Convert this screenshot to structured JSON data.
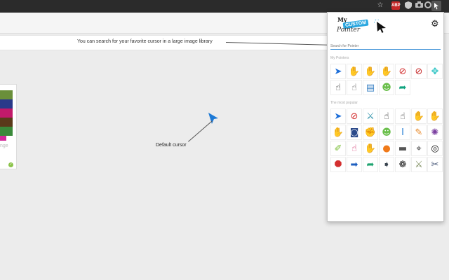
{
  "toolbar": {
    "icons": [
      "star-icon",
      "extension-badge-icon",
      "shield-icon",
      "camera-icon",
      "settings-extension-icon",
      "custom-pointer-extension-icon"
    ],
    "star_glyph": "☆",
    "badge_text": "ABP"
  },
  "page": {
    "info_text": "You can search for your favorite cursor in a large image library",
    "default_cursor_label": "Default cursor",
    "card_label": "nge"
  },
  "popup": {
    "logo": {
      "my": "My",
      "custom": "CUSTOM",
      "pointer": "Pointer"
    },
    "gear_glyph": "⚙",
    "search_placeholder": "Search for Pointer",
    "my_pointers_label": "My Pointers",
    "most_popular_label": "The most popular",
    "my_pointers": [
      {
        "name": "blue-arrow-cursor",
        "glyph": "➤",
        "color": "#1e6fd9"
      },
      {
        "name": "open-hand-cursor",
        "glyph": "✋",
        "color": "#e8b48a"
      },
      {
        "name": "raised-hand-cursor",
        "glyph": "✋",
        "color": "#f0c8a0"
      },
      {
        "name": "palm-hand-cursor",
        "glyph": "✋",
        "color": "#f2cba8"
      },
      {
        "name": "forbidden-hand-cursor",
        "glyph": "⊘",
        "color": "#d32f2f"
      },
      {
        "name": "forbidden-hand-cursor-2",
        "glyph": "⊘",
        "color": "#c62828"
      },
      {
        "name": "move-arrows-cursor",
        "glyph": "✥",
        "color": "#2ec4c4"
      },
      {
        "name": "pointing-hand-cursor",
        "glyph": "☝",
        "color": "#222222"
      },
      {
        "name": "pointing-hand-outline-cursor",
        "glyph": "☝",
        "color": "#555555"
      },
      {
        "name": "notepad-cursor",
        "glyph": "▤",
        "color": "#3b82c4"
      },
      {
        "name": "smiley-ball-cursor",
        "glyph": "☻",
        "color": "#6abf4b"
      },
      {
        "name": "teal-curved-arrow-cursor",
        "glyph": "➦",
        "color": "#10a37f"
      }
    ],
    "popular": [
      {
        "name": "blue-arrow-cursor",
        "glyph": "➤",
        "color": "#1e6fd9"
      },
      {
        "name": "forbidden-hand-cursor",
        "glyph": "⊘",
        "color": "#d32f2f"
      },
      {
        "name": "sword-cursor",
        "glyph": "⚔",
        "color": "#2a8fa8"
      },
      {
        "name": "pointing-hand-cursor",
        "glyph": "☝",
        "color": "#222222"
      },
      {
        "name": "pointing-hand-outline-cursor",
        "glyph": "☝",
        "color": "#444444"
      },
      {
        "name": "skin-hand-cursor",
        "glyph": "✋",
        "color": "#f0c8a0"
      },
      {
        "name": "palm-hand-cursor",
        "glyph": "✋",
        "color": "#f2cba8"
      },
      {
        "name": "open-hand-cursor",
        "glyph": "✋",
        "color": "#e8b48a"
      },
      {
        "name": "camera-cursor",
        "glyph": "◙",
        "color": "#2b4a8a"
      },
      {
        "name": "fist-hand-cursor",
        "glyph": "✊",
        "color": "#d9a07a"
      },
      {
        "name": "smiley-ball-cursor",
        "glyph": "☻",
        "color": "#6abf4b"
      },
      {
        "name": "text-beam-cursor",
        "glyph": "I",
        "color": "#2a7fd4"
      },
      {
        "name": "pencil-cursor",
        "glyph": "✎",
        "color": "#e88a2a"
      },
      {
        "name": "virus-cursor",
        "glyph": "✺",
        "color": "#7b3fa0"
      },
      {
        "name": "syringe-cursor",
        "glyph": "✐",
        "color": "#7dbf3b"
      },
      {
        "name": "foam-finger-cursor",
        "glyph": "☝",
        "color": "#d0306a"
      },
      {
        "name": "claw-hand-cursor",
        "glyph": "✋",
        "color": "#c06a4a"
      },
      {
        "name": "lollipop-cursor",
        "glyph": "●",
        "color": "#f07a1a"
      },
      {
        "name": "pistol-cursor",
        "glyph": "▬",
        "color": "#555555"
      },
      {
        "name": "crosshair-cursor",
        "glyph": "⌖",
        "color": "#333333"
      },
      {
        "name": "target-crosshair-cursor",
        "glyph": "◎",
        "color": "#111111"
      },
      {
        "name": "stop-sign-cursor",
        "glyph": "⯃",
        "color": "#d32f2f"
      },
      {
        "name": "blue-bar-arrow-cursor",
        "glyph": "➡",
        "color": "#1e5fbf"
      },
      {
        "name": "green-curved-arrow-cursor",
        "glyph": "➦",
        "color": "#1ea36f"
      },
      {
        "name": "tag-arrow-cursor",
        "glyph": "➧",
        "color": "#3a4550"
      },
      {
        "name": "paw-print-cursor",
        "glyph": "❁",
        "color": "#111111"
      },
      {
        "name": "knife-cursor",
        "glyph": "⚔",
        "color": "#7a8a5a"
      },
      {
        "name": "scissors-cursor",
        "glyph": "✂",
        "color": "#4a5a7a"
      }
    ]
  },
  "colors": {
    "accent": "#3a8fd6",
    "default_cursor": "#1e7ad6"
  }
}
